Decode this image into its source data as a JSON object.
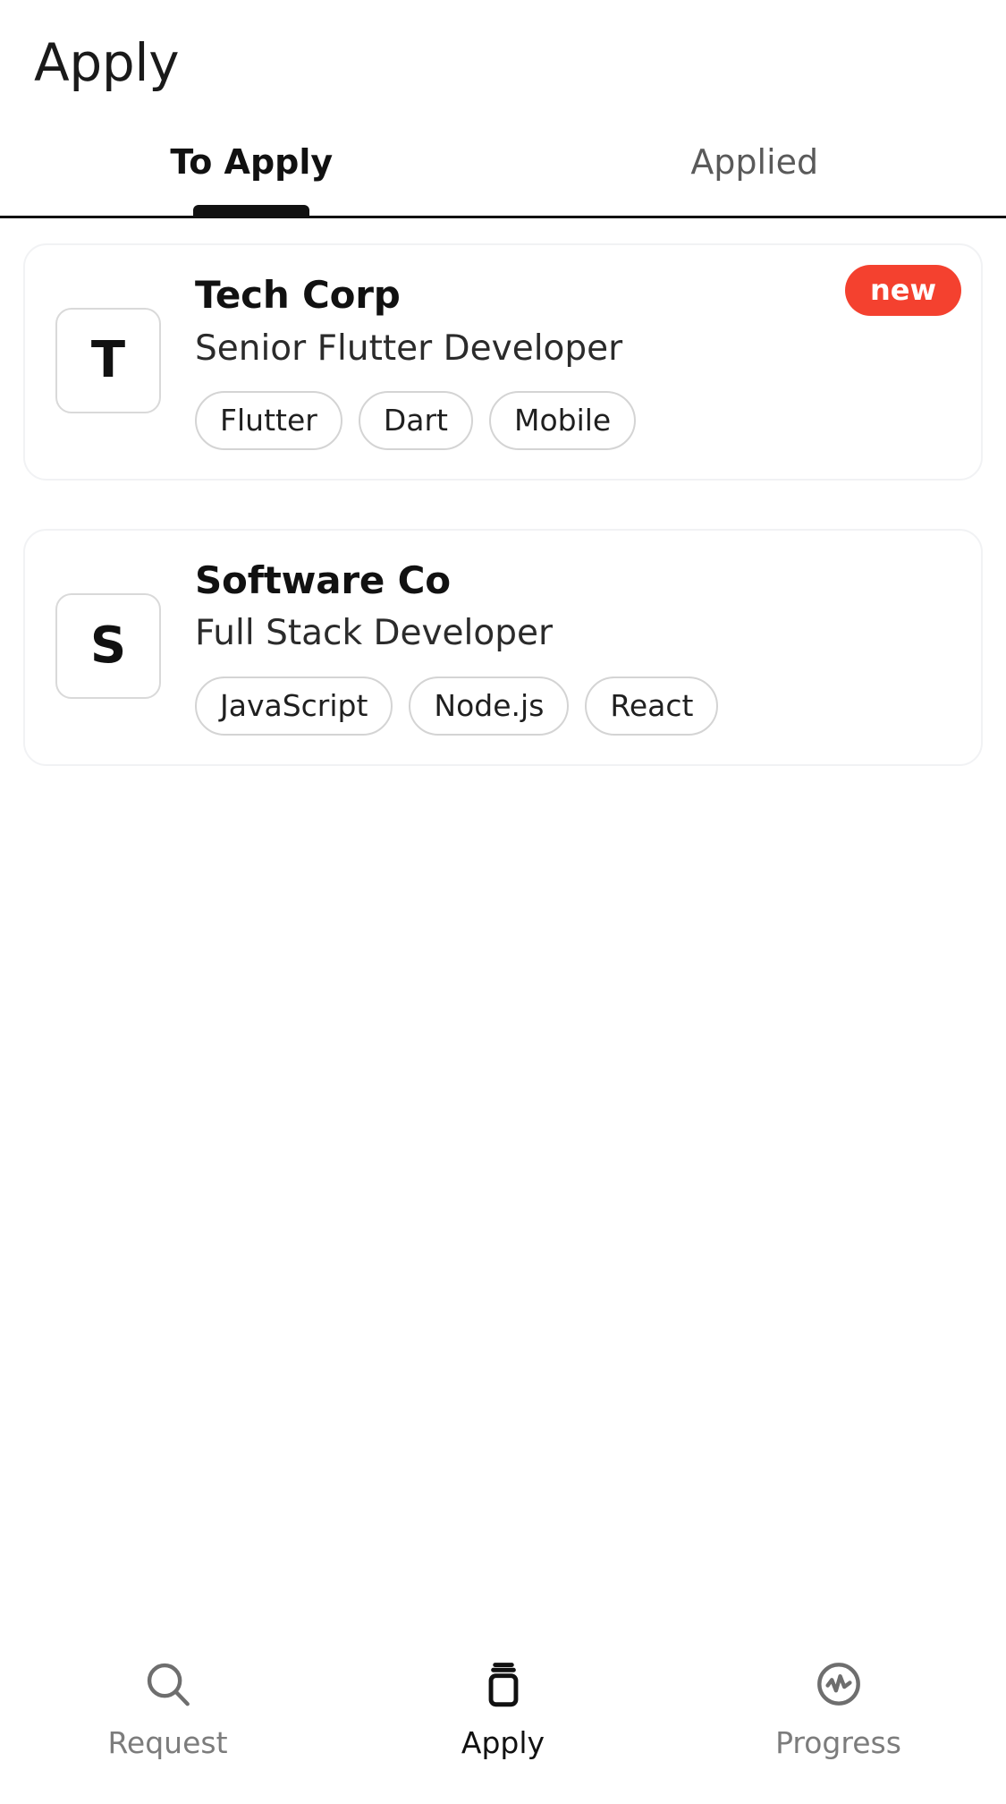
{
  "appbar": {
    "title": "Apply"
  },
  "tabs": {
    "items": [
      {
        "label": "To Apply",
        "active": true
      },
      {
        "label": "Applied",
        "active": false
      }
    ]
  },
  "jobs": [
    {
      "avatar_letter": "T",
      "company": "Tech Corp",
      "role": "Senior Flutter Developer",
      "badge": "new",
      "tags": [
        "Flutter",
        "Dart",
        "Mobile"
      ]
    },
    {
      "avatar_letter": "S",
      "company": "Software Co",
      "role": "Full Stack Developer",
      "badge": null,
      "tags": [
        "JavaScript",
        "Node.js",
        "React"
      ]
    }
  ],
  "bottom_nav": {
    "items": [
      {
        "label": "Request",
        "icon": "search-icon",
        "active": false
      },
      {
        "label": "Apply",
        "icon": "layers-icon",
        "active": true
      },
      {
        "label": "Progress",
        "icon": "pulse-circle-icon",
        "active": false
      }
    ]
  },
  "colors": {
    "badge_red": "#F4412F",
    "active_text": "#111111",
    "inactive_text": "#7C7C7C",
    "card_border": "#F1F2F4",
    "tag_border": "#D4D4D4"
  }
}
